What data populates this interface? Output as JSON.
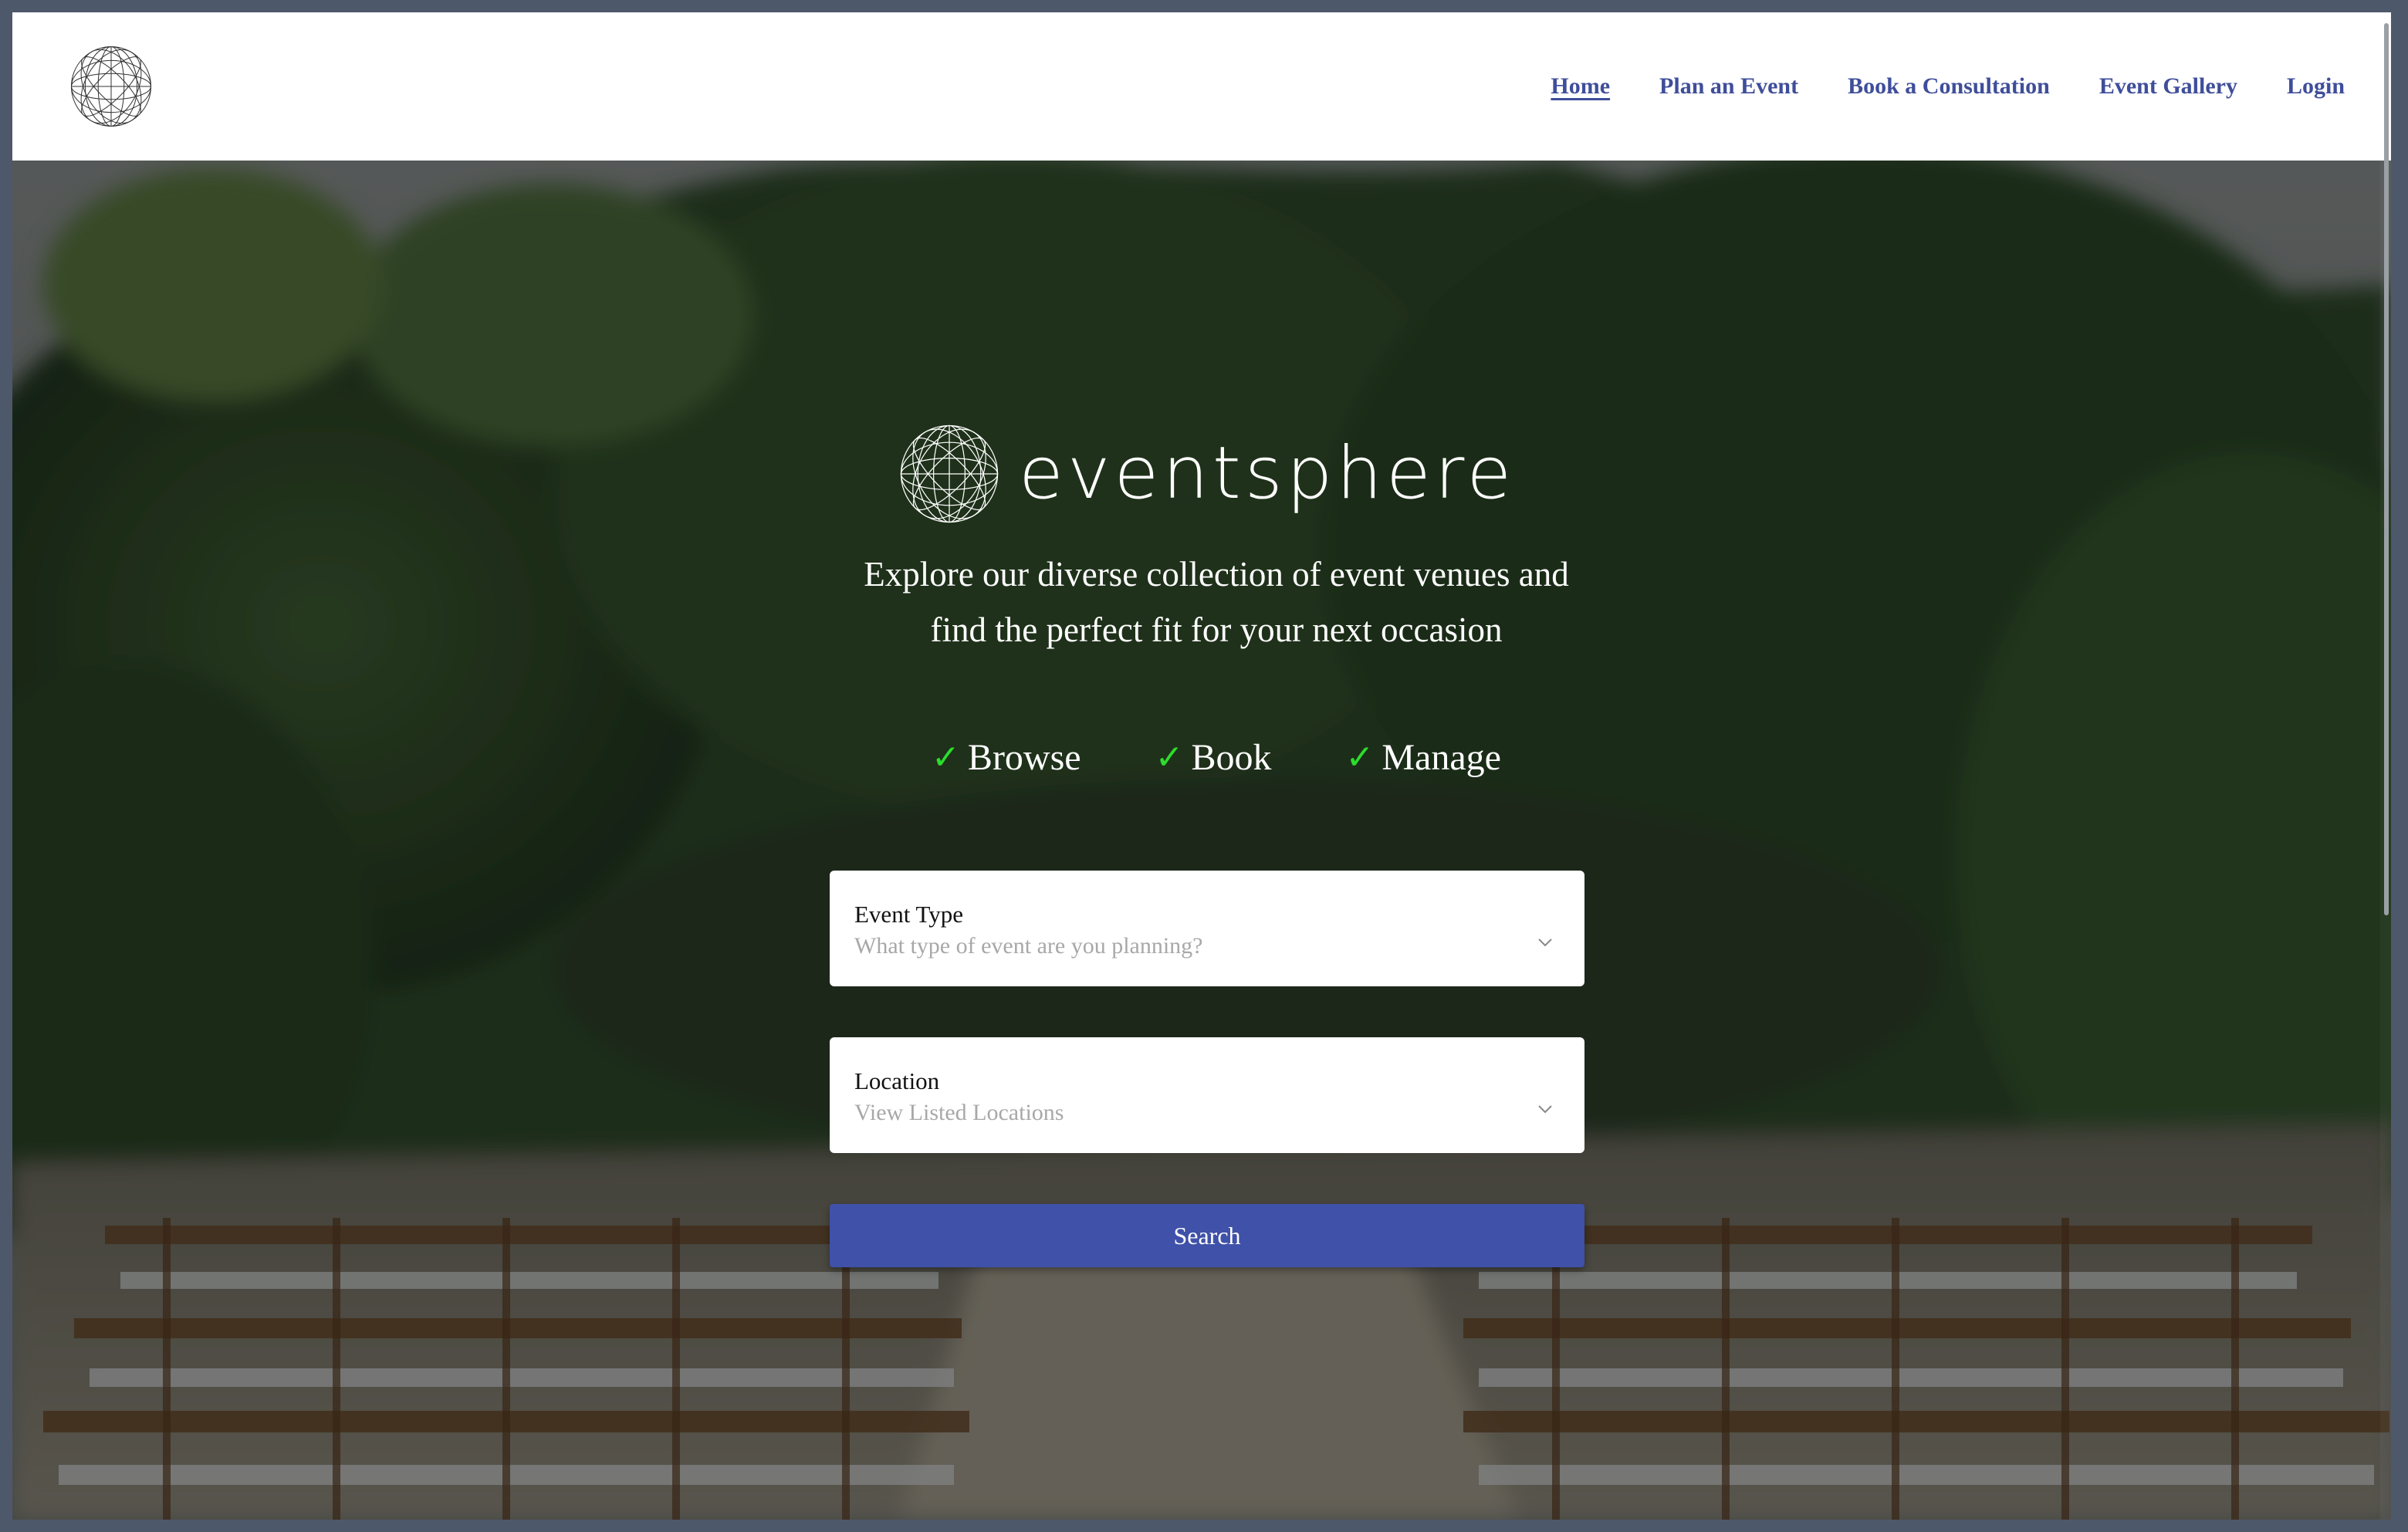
{
  "header": {
    "logo_icon": "geodesic-sphere-icon",
    "nav": [
      {
        "label": "Home",
        "active": true
      },
      {
        "label": "Plan an Event",
        "active": false
      },
      {
        "label": "Book a Consultation",
        "active": false
      },
      {
        "label": "Event Gallery",
        "active": false
      },
      {
        "label": "Login",
        "active": false
      }
    ]
  },
  "hero": {
    "brand_name": "eventsphere",
    "brand_icon": "geodesic-sphere-icon",
    "tagline_line1": "Explore our diverse collection of event venues and",
    "tagline_line2": "find the perfect fit for your next occasion",
    "features": [
      {
        "label": "Browse",
        "icon": "check-icon"
      },
      {
        "label": "Book",
        "icon": "check-icon"
      },
      {
        "label": "Manage",
        "icon": "check-icon"
      }
    ],
    "check_color": "#2ddc2d"
  },
  "form": {
    "event_type": {
      "label": "Event Type",
      "placeholder": "What type of event are you planning?"
    },
    "location": {
      "label": "Location",
      "placeholder": "View Listed Locations"
    },
    "search_label": "Search",
    "button_color": "#3f51a8"
  },
  "colors": {
    "nav_text": "#3f4e9a",
    "header_bg": "#ffffff"
  }
}
